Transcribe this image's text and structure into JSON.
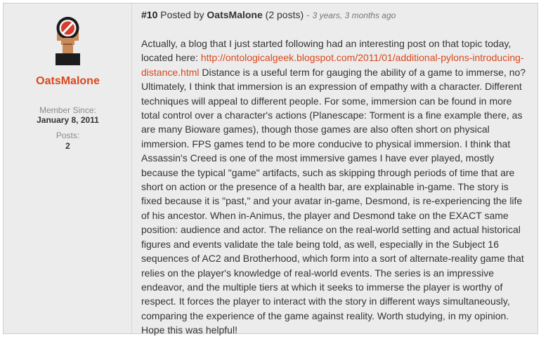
{
  "author": {
    "username": "OatsMalone",
    "member_since_label": "Member Since:",
    "member_since_value": "January 8, 2011",
    "posts_label": "Posts:",
    "posts_value": "2",
    "avatar_icon": "helmet-avatar-icon"
  },
  "post": {
    "number": "#10",
    "posted_by_label": "Posted by",
    "author": "OatsMalone",
    "post_count": "(2 posts)",
    "separator": "-",
    "time_ago": "3 years, 3 months ago",
    "body_before_link": "Actually, a blog that I just started following had an interesting post on that topic today, located here: ",
    "link_text": "http://ontologicalgeek.blogspot.com/2011/01/additional-pylons-introducing-distance.html",
    "body_after_link": " Distance is a useful term for gauging the ability of a game to immerse, no? Ultimately, I think that immersion is an expression of empathy with a character. Different techniques will appeal to different people. For some, immersion can be found in more total control over a character's actions (Planescape: Torment is a fine example there, as are many Bioware games), though those games are also often short on physical immersion. FPS games tend to be more conducive to physical immersion. I think that Assassin's Creed is one of the most immersive games I have ever played, mostly because the typical \"game\" artifacts, such as skipping through periods of time that are short on action or the presence of a health bar, are explainable in-game. The story is fixed because it is \"past,\" and your avatar in-game, Desmond, is re-experiencing the life of his ancestor. When in-Animus, the player and Desmond take on the EXACT same position: audience and actor. The reliance on the real-world setting and actual historical figures and events validate the tale being told, as well, especially in the Subject 16 sequences of AC2 and Brotherhood, which form into a sort of alternate-reality game that relies on the player's knowledge of real-world events. The series is an impressive endeavor, and the multiple tiers at which it seeks to immerse the player is worthy of respect. It forces the player to interact with the story in different ways simultaneously, comparing the experience of the game against reality. Worth studying, in my opinion. Hope this was helpful!"
  },
  "colors": {
    "accent": "#d9481c",
    "panel_bg": "#ececec",
    "text": "#333333"
  }
}
